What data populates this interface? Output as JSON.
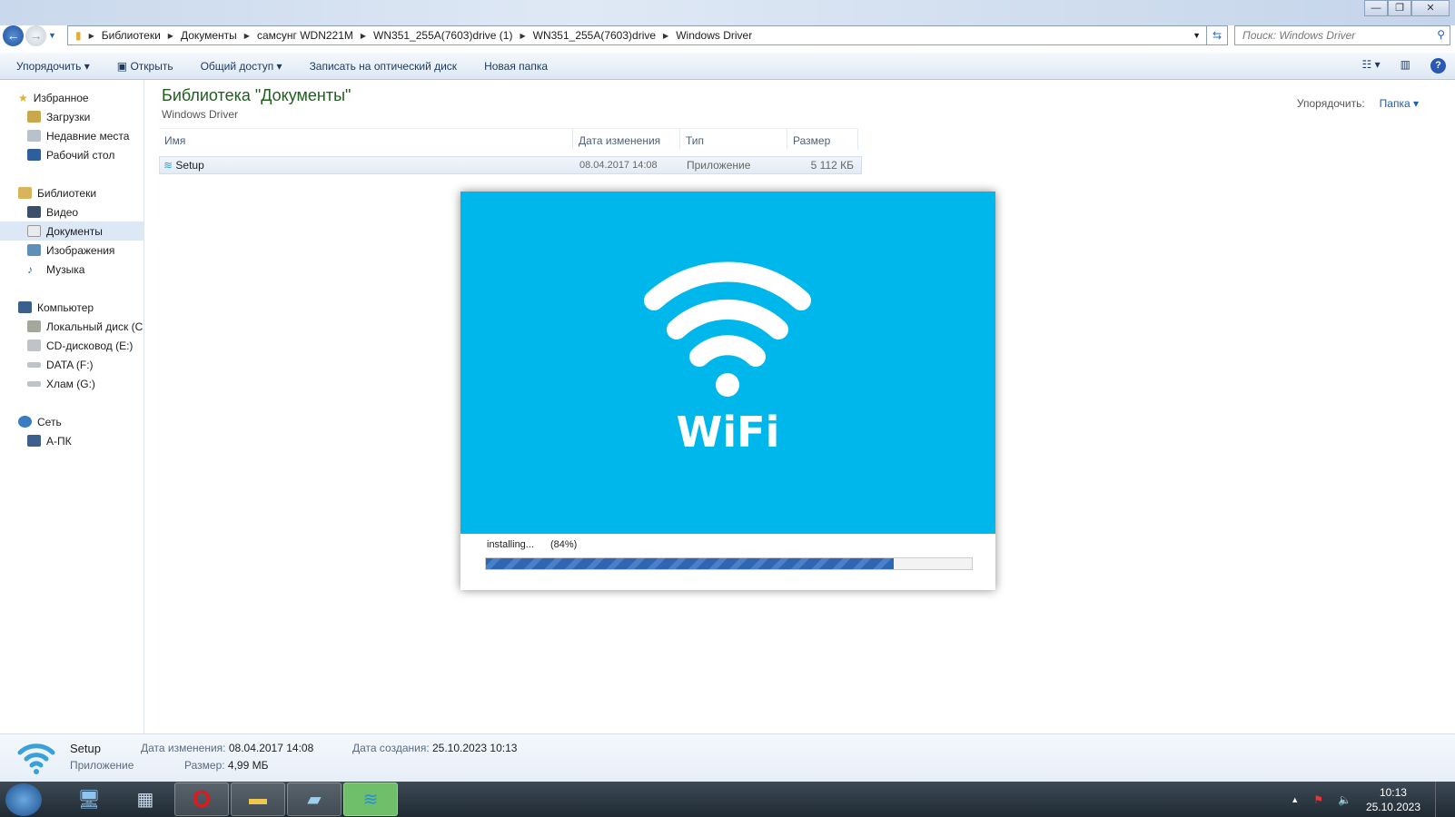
{
  "window": {
    "minimize": "—",
    "restore": "❐",
    "close": "✕"
  },
  "address": {
    "crumbs": [
      "Библиотеки",
      "Документы",
      "самсунг WDN221M",
      "WN351_255A(7603)drive (1)",
      "WN351_255A(7603)drive",
      "Windows Driver"
    ],
    "search_placeholder": "Поиск: Windows Driver"
  },
  "toolbar": {
    "organize": "Упорядочить ▾",
    "open": "Открыть",
    "share": "Общий доступ ▾",
    "burn": "Записать на оптический диск",
    "new_folder": "Новая папка"
  },
  "sidebar": {
    "favorites": "Избранное",
    "fav_items": [
      "Загрузки",
      "Недавние места",
      "Рабочий стол"
    ],
    "libraries": "Библиотеки",
    "lib_items": [
      "Видео",
      "Документы",
      "Изображения",
      "Музыка"
    ],
    "computer": "Компьютер",
    "comp_items": [
      "Локальный диск (C",
      "CD-дисковод (E:)",
      "DATA (F:)",
      "Хлам (G:)"
    ],
    "network": "Сеть",
    "net_items": [
      "А-ПК"
    ]
  },
  "content": {
    "title": "Библиотека \"Документы\"",
    "subtitle": "Windows Driver",
    "sort_label": "Упорядочить:",
    "sort_value": "Папка ▾",
    "columns": [
      "Имя",
      "Дата изменения",
      "Тип",
      "Размер"
    ],
    "rows": [
      {
        "name": "Setup",
        "date": "08.04.2017 14:08",
        "type": "Приложение",
        "size": "5 112 КБ"
      }
    ]
  },
  "installer": {
    "logo_text": "WiFi",
    "status": "installing...",
    "percent_label": "(84%)",
    "progress": 0.84,
    "brand_color": "#00b7ec"
  },
  "details": {
    "name": "Setup",
    "type": "Приложение",
    "modified_label": "Дата изменения:",
    "modified": "08.04.2017 14:08",
    "size_label": "Размер:",
    "size": "4,99 МБ",
    "created_label": "Дата создания:",
    "created": "25.10.2023 10:13"
  },
  "taskbar": {
    "time": "10:13",
    "date": "25.10.2023"
  }
}
